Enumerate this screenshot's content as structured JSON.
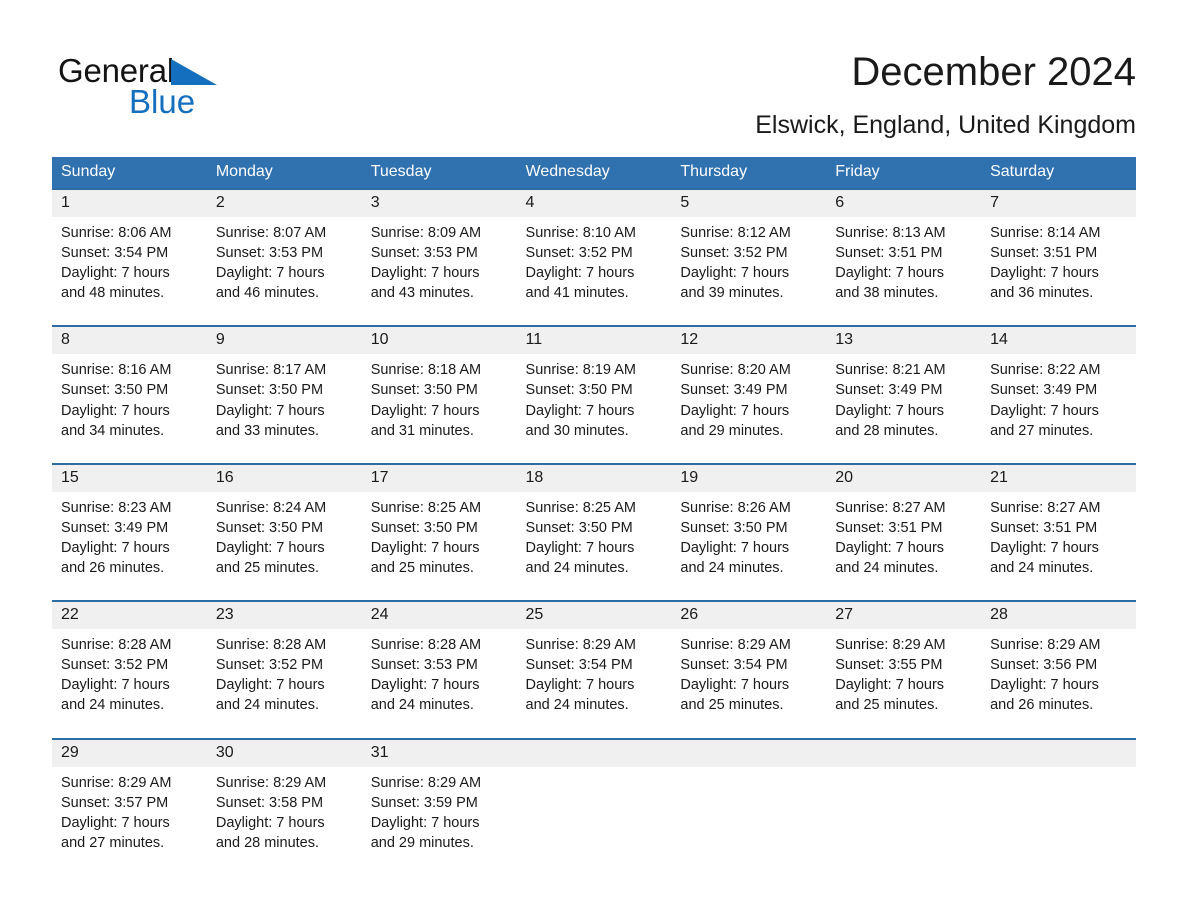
{
  "brand": {
    "name_part1": "General",
    "name_part2": "Blue",
    "triangle_color": "#1470BE",
    "text_color": "#141414"
  },
  "header": {
    "title": "December 2024",
    "subtitle": "Elswick, England, United Kingdom"
  },
  "theme": {
    "header_blue": "#3071B0",
    "row_divider_blue": "#2E6DA4",
    "daynum_band": "#F0F0F0",
    "page_background": "#FFFFFF"
  },
  "calendar": {
    "weekday_headers": [
      "Sunday",
      "Monday",
      "Tuesday",
      "Wednesday",
      "Thursday",
      "Friday",
      "Saturday"
    ],
    "weeks": [
      [
        {
          "day": "1",
          "sunrise": "Sunrise: 8:06 AM",
          "sunset": "Sunset: 3:54 PM",
          "daylight_line1": "Daylight: 7 hours",
          "daylight_line2": "and 48 minutes."
        },
        {
          "day": "2",
          "sunrise": "Sunrise: 8:07 AM",
          "sunset": "Sunset: 3:53 PM",
          "daylight_line1": "Daylight: 7 hours",
          "daylight_line2": "and 46 minutes."
        },
        {
          "day": "3",
          "sunrise": "Sunrise: 8:09 AM",
          "sunset": "Sunset: 3:53 PM",
          "daylight_line1": "Daylight: 7 hours",
          "daylight_line2": "and 43 minutes."
        },
        {
          "day": "4",
          "sunrise": "Sunrise: 8:10 AM",
          "sunset": "Sunset: 3:52 PM",
          "daylight_line1": "Daylight: 7 hours",
          "daylight_line2": "and 41 minutes."
        },
        {
          "day": "5",
          "sunrise": "Sunrise: 8:12 AM",
          "sunset": "Sunset: 3:52 PM",
          "daylight_line1": "Daylight: 7 hours",
          "daylight_line2": "and 39 minutes."
        },
        {
          "day": "6",
          "sunrise": "Sunrise: 8:13 AM",
          "sunset": "Sunset: 3:51 PM",
          "daylight_line1": "Daylight: 7 hours",
          "daylight_line2": "and 38 minutes."
        },
        {
          "day": "7",
          "sunrise": "Sunrise: 8:14 AM",
          "sunset": "Sunset: 3:51 PM",
          "daylight_line1": "Daylight: 7 hours",
          "daylight_line2": "and 36 minutes."
        }
      ],
      [
        {
          "day": "8",
          "sunrise": "Sunrise: 8:16 AM",
          "sunset": "Sunset: 3:50 PM",
          "daylight_line1": "Daylight: 7 hours",
          "daylight_line2": "and 34 minutes."
        },
        {
          "day": "9",
          "sunrise": "Sunrise: 8:17 AM",
          "sunset": "Sunset: 3:50 PM",
          "daylight_line1": "Daylight: 7 hours",
          "daylight_line2": "and 33 minutes."
        },
        {
          "day": "10",
          "sunrise": "Sunrise: 8:18 AM",
          "sunset": "Sunset: 3:50 PM",
          "daylight_line1": "Daylight: 7 hours",
          "daylight_line2": "and 31 minutes."
        },
        {
          "day": "11",
          "sunrise": "Sunrise: 8:19 AM",
          "sunset": "Sunset: 3:50 PM",
          "daylight_line1": "Daylight: 7 hours",
          "daylight_line2": "and 30 minutes."
        },
        {
          "day": "12",
          "sunrise": "Sunrise: 8:20 AM",
          "sunset": "Sunset: 3:49 PM",
          "daylight_line1": "Daylight: 7 hours",
          "daylight_line2": "and 29 minutes."
        },
        {
          "day": "13",
          "sunrise": "Sunrise: 8:21 AM",
          "sunset": "Sunset: 3:49 PM",
          "daylight_line1": "Daylight: 7 hours",
          "daylight_line2": "and 28 minutes."
        },
        {
          "day": "14",
          "sunrise": "Sunrise: 8:22 AM",
          "sunset": "Sunset: 3:49 PM",
          "daylight_line1": "Daylight: 7 hours",
          "daylight_line2": "and 27 minutes."
        }
      ],
      [
        {
          "day": "15",
          "sunrise": "Sunrise: 8:23 AM",
          "sunset": "Sunset: 3:49 PM",
          "daylight_line1": "Daylight: 7 hours",
          "daylight_line2": "and 26 minutes."
        },
        {
          "day": "16",
          "sunrise": "Sunrise: 8:24 AM",
          "sunset": "Sunset: 3:50 PM",
          "daylight_line1": "Daylight: 7 hours",
          "daylight_line2": "and 25 minutes."
        },
        {
          "day": "17",
          "sunrise": "Sunrise: 8:25 AM",
          "sunset": "Sunset: 3:50 PM",
          "daylight_line1": "Daylight: 7 hours",
          "daylight_line2": "and 25 minutes."
        },
        {
          "day": "18",
          "sunrise": "Sunrise: 8:25 AM",
          "sunset": "Sunset: 3:50 PM",
          "daylight_line1": "Daylight: 7 hours",
          "daylight_line2": "and 24 minutes."
        },
        {
          "day": "19",
          "sunrise": "Sunrise: 8:26 AM",
          "sunset": "Sunset: 3:50 PM",
          "daylight_line1": "Daylight: 7 hours",
          "daylight_line2": "and 24 minutes."
        },
        {
          "day": "20",
          "sunrise": "Sunrise: 8:27 AM",
          "sunset": "Sunset: 3:51 PM",
          "daylight_line1": "Daylight: 7 hours",
          "daylight_line2": "and 24 minutes."
        },
        {
          "day": "21",
          "sunrise": "Sunrise: 8:27 AM",
          "sunset": "Sunset: 3:51 PM",
          "daylight_line1": "Daylight: 7 hours",
          "daylight_line2": "and 24 minutes."
        }
      ],
      [
        {
          "day": "22",
          "sunrise": "Sunrise: 8:28 AM",
          "sunset": "Sunset: 3:52 PM",
          "daylight_line1": "Daylight: 7 hours",
          "daylight_line2": "and 24 minutes."
        },
        {
          "day": "23",
          "sunrise": "Sunrise: 8:28 AM",
          "sunset": "Sunset: 3:52 PM",
          "daylight_line1": "Daylight: 7 hours",
          "daylight_line2": "and 24 minutes."
        },
        {
          "day": "24",
          "sunrise": "Sunrise: 8:28 AM",
          "sunset": "Sunset: 3:53 PM",
          "daylight_line1": "Daylight: 7 hours",
          "daylight_line2": "and 24 minutes."
        },
        {
          "day": "25",
          "sunrise": "Sunrise: 8:29 AM",
          "sunset": "Sunset: 3:54 PM",
          "daylight_line1": "Daylight: 7 hours",
          "daylight_line2": "and 24 minutes."
        },
        {
          "day": "26",
          "sunrise": "Sunrise: 8:29 AM",
          "sunset": "Sunset: 3:54 PM",
          "daylight_line1": "Daylight: 7 hours",
          "daylight_line2": "and 25 minutes."
        },
        {
          "day": "27",
          "sunrise": "Sunrise: 8:29 AM",
          "sunset": "Sunset: 3:55 PM",
          "daylight_line1": "Daylight: 7 hours",
          "daylight_line2": "and 25 minutes."
        },
        {
          "day": "28",
          "sunrise": "Sunrise: 8:29 AM",
          "sunset": "Sunset: 3:56 PM",
          "daylight_line1": "Daylight: 7 hours",
          "daylight_line2": "and 26 minutes."
        }
      ],
      [
        {
          "day": "29",
          "sunrise": "Sunrise: 8:29 AM",
          "sunset": "Sunset: 3:57 PM",
          "daylight_line1": "Daylight: 7 hours",
          "daylight_line2": "and 27 minutes."
        },
        {
          "day": "30",
          "sunrise": "Sunrise: 8:29 AM",
          "sunset": "Sunset: 3:58 PM",
          "daylight_line1": "Daylight: 7 hours",
          "daylight_line2": "and 28 minutes."
        },
        {
          "day": "31",
          "sunrise": "Sunrise: 8:29 AM",
          "sunset": "Sunset: 3:59 PM",
          "daylight_line1": "Daylight: 7 hours",
          "daylight_line2": "and 29 minutes."
        },
        {
          "day": "",
          "sunrise": "",
          "sunset": "",
          "daylight_line1": "",
          "daylight_line2": ""
        },
        {
          "day": "",
          "sunrise": "",
          "sunset": "",
          "daylight_line1": "",
          "daylight_line2": ""
        },
        {
          "day": "",
          "sunrise": "",
          "sunset": "",
          "daylight_line1": "",
          "daylight_line2": ""
        },
        {
          "day": "",
          "sunrise": "",
          "sunset": "",
          "daylight_line1": "",
          "daylight_line2": ""
        }
      ]
    ]
  }
}
